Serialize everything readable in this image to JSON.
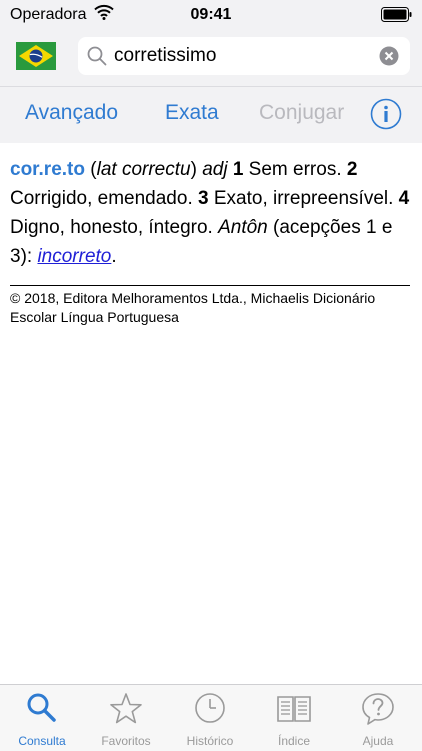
{
  "status_bar": {
    "carrier": "Operadora",
    "time": "09:41"
  },
  "search": {
    "value": "corretissimo",
    "placeholder": ""
  },
  "segments": [
    {
      "label": "Avançado",
      "enabled": true
    },
    {
      "label": "Exata",
      "enabled": true
    },
    {
      "label": "Conjugar",
      "enabled": false
    }
  ],
  "entry": {
    "headword": "cor.re.to",
    "paren_open": " (",
    "etymology": "lat correctu",
    "paren_close": ") ",
    "pos": "adj",
    "sense1_num": " 1",
    "sense1_text": " Sem erros. ",
    "sense2_num": "2",
    "sense2_text": " Corrigido, emendado. ",
    "sense3_num": "3",
    "sense3_text": " Exato, irrepreensível. ",
    "sense4_num": "4",
    "sense4_text": " Digno, honesto, íntegro.",
    "antonym_label": "Antôn",
    "antonym_note": " (acepções 1 e 3): ",
    "antonym_link": "incorreto",
    "end_period": "."
  },
  "copyright": "© 2018, Editora Melhoramentos Ltda., Michaelis Dicionário Escolar Língua Portuguesa",
  "tabs": [
    {
      "label": "Consulta",
      "icon": "search-icon",
      "active": true
    },
    {
      "label": "Favoritos",
      "icon": "star-icon",
      "active": false
    },
    {
      "label": "Histórico",
      "icon": "clock-icon",
      "active": false
    },
    {
      "label": "Índice",
      "icon": "book-icon",
      "active": false
    },
    {
      "label": "Ajuda",
      "icon": "help-icon",
      "active": false
    }
  ],
  "colors": {
    "accent": "#2f7bd1",
    "disabled": "#b9b9be",
    "link": "#1f1fd6",
    "tab_inactive": "#9a9a9a"
  }
}
